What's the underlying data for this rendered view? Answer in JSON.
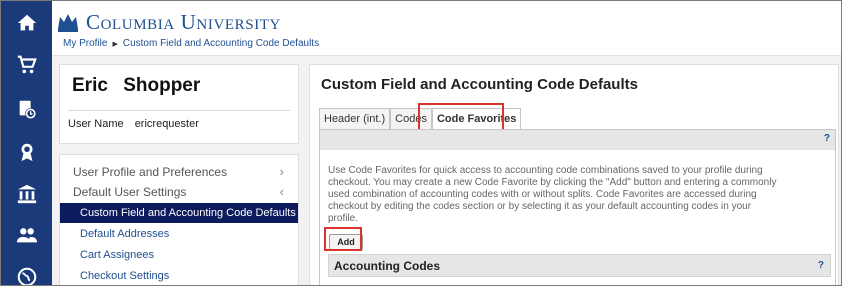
{
  "rail": {
    "icons": [
      "home-icon",
      "cart-icon",
      "orders-clock-icon",
      "award-icon",
      "bank-icon",
      "users-icon",
      "globe-icon"
    ]
  },
  "header": {
    "brand": "Columbia University",
    "breadcrumb": [
      "My Profile",
      "Custom Field and Accounting Code Defaults"
    ]
  },
  "profile": {
    "first_name": "Eric",
    "last_name": "Shopper",
    "username_label": "User Name",
    "username_value": "ericrequester"
  },
  "nav": {
    "items": [
      {
        "label": "User Profile and Preferences"
      },
      {
        "label": "Default User Settings"
      },
      {
        "label": "Custom Field and Accounting Code Defaults"
      },
      {
        "label": "Default Addresses"
      },
      {
        "label": "Cart Assignees"
      },
      {
        "label": "Checkout Settings"
      }
    ]
  },
  "main": {
    "title": "Custom Field and Accounting Code Defaults",
    "tabs": [
      {
        "label": "Header (int.)"
      },
      {
        "label": "Codes"
      },
      {
        "label": "Code Favorites"
      }
    ],
    "help": "?",
    "description": "Use Code Favorites for quick access to accounting code combinations saved to your profile during checkout. You may create a new Code Favorite by clicking the \"Add\" button and entering a commonly used combination of accounting codes with or without splits. Code Favorites are accessed during checkout by editing the codes section or by selecting it as your default accounting codes in your profile.",
    "add_label": "Add",
    "section_title": "Accounting Codes",
    "section_help": "?"
  },
  "colors": {
    "rail": "#1b3a7a",
    "brand": "#1d4f91",
    "active_nav": "#0b1b5c",
    "highlight": "#d9342b"
  }
}
